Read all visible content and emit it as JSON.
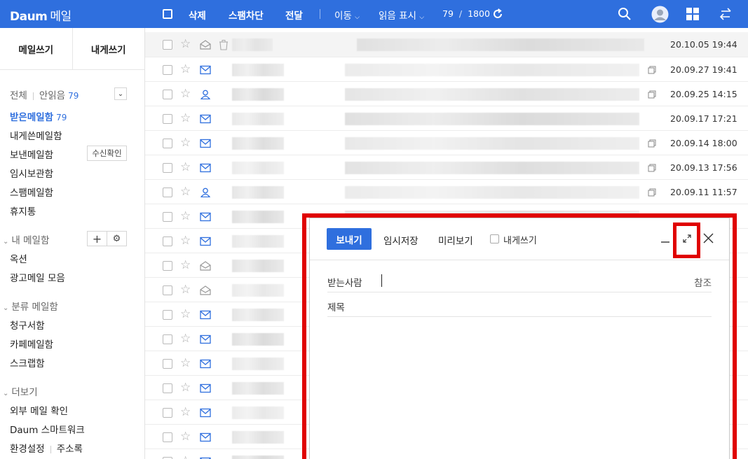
{
  "topbar": {
    "logo": "Daum",
    "service": "메일",
    "delete": "삭제",
    "spam_block": "스팸차단",
    "forward": "전달",
    "move": "이동",
    "mark_read": "읽음 표시",
    "page_current": "79",
    "page_sep": "/",
    "page_total": "1800"
  },
  "sidebar": {
    "write_mail": "메일쓰기",
    "write_self": "내게쓰기",
    "all": "전체",
    "unread": "안읽음",
    "unread_count": "79",
    "inbox": "받은메일함",
    "inbox_count": "79",
    "self_box": "내게쓴메일함",
    "sent": "보낸메일함",
    "receipt_check": "수신확인",
    "drafts": "임시보관함",
    "spam": "스팸메일함",
    "trash": "휴지통",
    "my_mailbox": "내 메일함",
    "option": "옥션",
    "ads": "광고메일 모음",
    "category": "분류 메일함",
    "bills": "청구서함",
    "cafe": "카페메일함",
    "scrap": "스크랩함",
    "more": "더보기",
    "external": "외부 메일 확인",
    "smartwork": "Daum 스마트워크",
    "settings": "환경설정",
    "address": "주소록"
  },
  "mails": [
    {
      "date": "20.10.05 19:44",
      "type": "read",
      "copy": false
    },
    {
      "date": "20.09.27 19:41",
      "type": "mail",
      "copy": true
    },
    {
      "date": "20.09.25 14:15",
      "type": "person",
      "copy": true
    },
    {
      "date": "20.09.17 17:21",
      "type": "mail",
      "copy": false
    },
    {
      "date": "20.09.14 18:00",
      "type": "mail",
      "copy": true
    },
    {
      "date": "20.09.13 17:56",
      "type": "mail",
      "copy": true
    },
    {
      "date": "20.09.11 11:57",
      "type": "person",
      "copy": true
    },
    {
      "date": "",
      "type": "mail",
      "copy": false
    },
    {
      "date": "",
      "type": "mail",
      "copy": false
    },
    {
      "date": "",
      "type": "read",
      "copy": false
    },
    {
      "date": "",
      "type": "read",
      "copy": false
    },
    {
      "date": "",
      "type": "mail",
      "copy": false
    },
    {
      "date": "",
      "type": "mail",
      "copy": false
    },
    {
      "date": "",
      "type": "mail",
      "copy": false
    },
    {
      "date": "",
      "type": "mail",
      "copy": false
    },
    {
      "date": "",
      "type": "mail",
      "copy": false
    },
    {
      "date": "",
      "type": "mail",
      "copy": false
    },
    {
      "date": "",
      "type": "mail",
      "copy": false
    }
  ],
  "compose": {
    "send": "보내기",
    "save_draft": "임시저장",
    "preview": "미리보기",
    "to_self": "내게쓰기",
    "recipient_label": "받는사람",
    "cc": "참조",
    "subject_label": "제목"
  },
  "colors": {
    "brand": "#2f6fde",
    "highlight": "#e00000"
  }
}
